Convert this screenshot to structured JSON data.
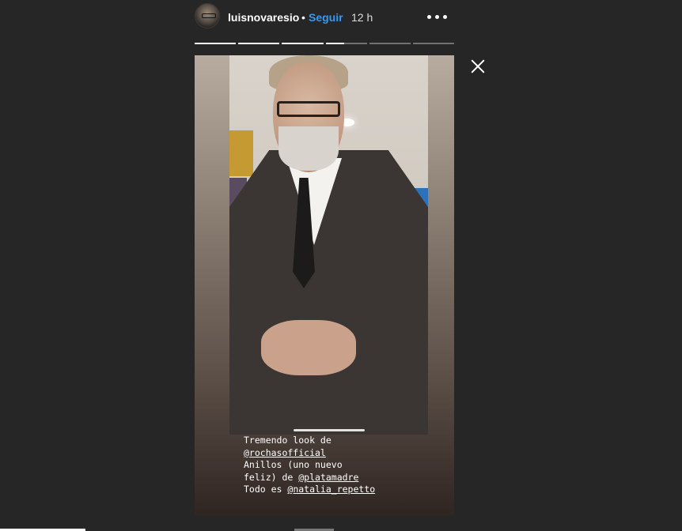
{
  "header": {
    "username": "luisnovaresio",
    "separator": "•",
    "follow_label": "Seguir",
    "time": "12 h",
    "more_icon": "more-horizontal-icon"
  },
  "progress": [
    1,
    1,
    1,
    0.45,
    0,
    0
  ],
  "close_icon": "close-icon",
  "caption": {
    "line1": "Tremendo look de",
    "mention1": "@rochasofficial",
    "line3": "Anillos (uno nuevo",
    "line4_pre": "feliz) de ",
    "mention2": "@platamadre",
    "line5_pre": "Todo es ",
    "mention3": "@natalia_repetto"
  },
  "colors": {
    "background": "#262626",
    "follow": "#3897f0"
  }
}
